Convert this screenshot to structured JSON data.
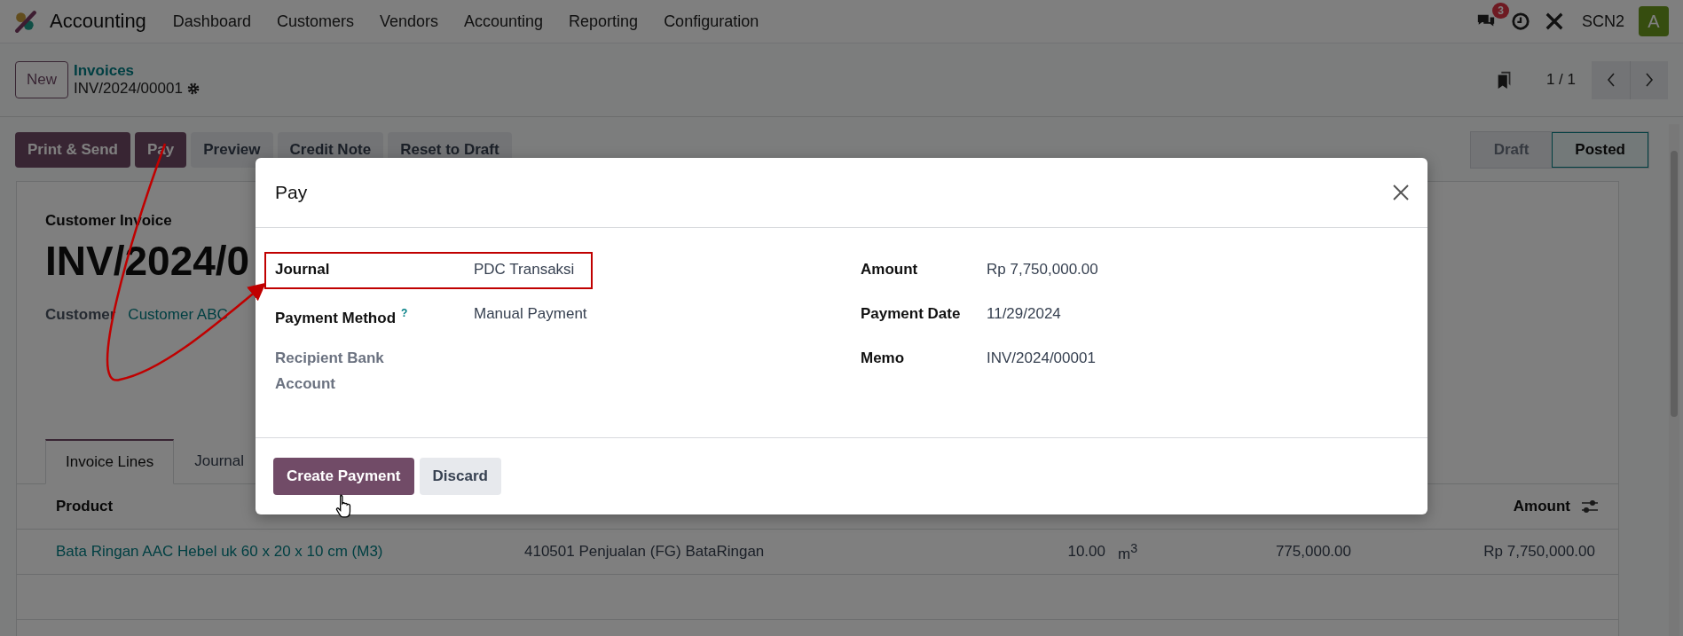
{
  "navbar": {
    "app": "Accounting",
    "menu": [
      "Dashboard",
      "Customers",
      "Vendors",
      "Accounting",
      "Reporting",
      "Configuration"
    ],
    "notification_count": "3",
    "company": "SCN2",
    "avatar": "A"
  },
  "breadcrumb": {
    "new_button": "New",
    "parent": "Invoices",
    "current": "INV/2024/00001"
  },
  "pager": "1 / 1",
  "actions": [
    {
      "label": "Print & Send",
      "kind": "primary"
    },
    {
      "label": "Pay",
      "kind": "primary"
    },
    {
      "label": "Preview",
      "kind": "secondary"
    },
    {
      "label": "Credit Note",
      "kind": "secondary"
    },
    {
      "label": "Reset to Draft",
      "kind": "secondary"
    }
  ],
  "status": [
    {
      "label": "Draft",
      "selected": false
    },
    {
      "label": "Posted",
      "selected": true
    }
  ],
  "invoice": {
    "type": "Customer Invoice",
    "number": "INV/2024/0",
    "customer_label": "Customer",
    "customer": "Customer ABC"
  },
  "tabs": [
    {
      "label": "Invoice Lines",
      "selected": true
    },
    {
      "label": "Journal",
      "selected": false
    }
  ],
  "table": {
    "columns": [
      "Product",
      "Amount"
    ],
    "rows": [
      {
        "product": "Bata Ringan AAC Hebel uk 60 x 20 x 10 cm (M3)",
        "account": "410501 Penjualan (FG) BataRingan",
        "quantity": "10.00",
        "unit": "m$^{3}$",
        "price": "775,000.00",
        "amount": "Rp 7,750,000.00"
      }
    ]
  },
  "dialog": {
    "title": "Pay",
    "left_fields": [
      {
        "label": "Journal",
        "value": "PDC Transaksi",
        "muted": false
      },
      {
        "label": "Payment Method",
        "help": "?",
        "value": "Manual Payment",
        "muted": false
      },
      {
        "label": "Recipient Bank Account",
        "muted": true
      }
    ],
    "right_fields": [
      {
        "label": "Amount",
        "value": "Rp 7,750,000.00"
      },
      {
        "label": "Payment Date",
        "value": "11/29/2024"
      },
      {
        "label": "Memo",
        "value": "INV/2024/00001"
      }
    ],
    "buttons": [
      {
        "label": "Create Payment",
        "kind": "primary"
      },
      {
        "label": "Discard",
        "kind": "secondary"
      }
    ]
  }
}
